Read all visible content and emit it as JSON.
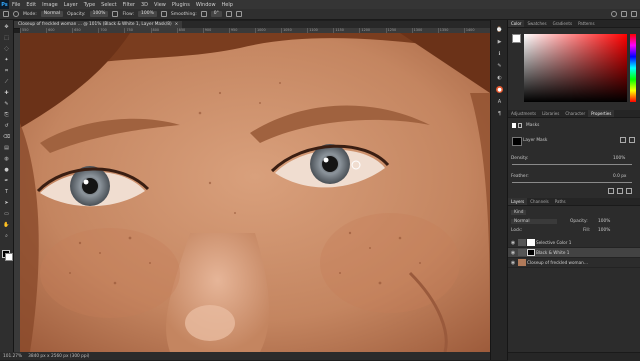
{
  "menu": [
    "File",
    "Edit",
    "Image",
    "Layer",
    "Type",
    "Select",
    "Filter",
    "3D",
    "View",
    "Plugins",
    "Window",
    "Help"
  ],
  "options": {
    "mode_label": "Mode:",
    "mode_value": "Normal",
    "opacity_label": "Opacity:",
    "opacity_value": "100%",
    "flow_label": "Flow:",
    "flow_value": "100%",
    "smoothing_label": "Smoothing:",
    "angle_value": "0°"
  },
  "document_tab": {
    "title": "Closeup of freckled woman … @ 101% (Black & White 1, Layer Mask/8)",
    "close": "×"
  },
  "ruler_ticks": [
    "550",
    "600",
    "650",
    "700",
    "750",
    "800",
    "850",
    "900",
    "950",
    "1000",
    "1050",
    "1100",
    "1150",
    "1200",
    "1250",
    "1300",
    "1350",
    "1400"
  ],
  "status": {
    "zoom": "101.27%",
    "doc_info": "3840 px x 2560 px (300 ppi)"
  },
  "color_panel": {
    "tabs": [
      "Color",
      "Swatches",
      "Gradients",
      "Patterns"
    ],
    "active": "Color",
    "hue_accent": "#ff0000"
  },
  "properties_panel": {
    "tabs": [
      "Adjustments",
      "Libraries",
      "Character",
      "Properties"
    ],
    "active": "Properties",
    "section": "Masks",
    "mask_type": "Layer Mask",
    "density_label": "Density:",
    "density_value": "100%",
    "feather_label": "Feather:",
    "feather_value": "0.0 px"
  },
  "layers_panel": {
    "tabs": [
      "Layers",
      "Channels",
      "Paths"
    ],
    "active": "Layers",
    "filter_label": "Kind",
    "blend_mode": "Normal",
    "opacity_label": "Opacity:",
    "opacity_value": "100%",
    "lock_label": "Lock:",
    "fill_label": "Fill:",
    "fill_value": "100%",
    "layers": [
      {
        "name": "Selective Color 1",
        "visible": true
      },
      {
        "name": "Black & White 1",
        "visible": true,
        "selected": true
      },
      {
        "name": "Closeup of freckled woman…",
        "visible": true
      }
    ]
  },
  "icons": [
    "move-icon",
    "marquee-icon",
    "lasso-icon",
    "quick-select-icon",
    "crop-icon",
    "eyedropper-icon",
    "heal-icon",
    "brush-icon",
    "stamp-icon",
    "history-brush-icon",
    "eraser-icon",
    "gradient-icon",
    "blur-icon",
    "dodge-icon",
    "pen-icon",
    "type-icon",
    "path-select-icon",
    "shape-icon",
    "hand-icon",
    "zoom-icon"
  ]
}
